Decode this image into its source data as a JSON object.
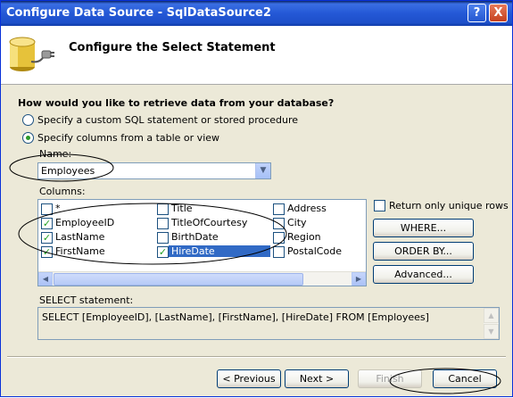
{
  "window": {
    "title": "Configure Data Source - SqlDataSource2",
    "help_glyph": "?",
    "close_glyph": "X"
  },
  "header": {
    "step_title": "Configure the Select Statement",
    "icon": "database-icon"
  },
  "retrieve": {
    "question": "How would you like to retrieve data from your database?",
    "options": [
      {
        "label": "Specify a custom SQL statement or stored procedure",
        "selected": false
      },
      {
        "label": "Specify columns from a table or view",
        "selected": true
      }
    ]
  },
  "name_field": {
    "label": "Name:",
    "value": "Employees"
  },
  "columns": {
    "label": "Columns:",
    "items": [
      {
        "label": "*",
        "checked": false
      },
      {
        "label": "EmployeeID",
        "checked": true
      },
      {
        "label": "LastName",
        "checked": true
      },
      {
        "label": "FirstName",
        "checked": true
      },
      {
        "label": "Title",
        "checked": false
      },
      {
        "label": "TitleOfCourtesy",
        "checked": false
      },
      {
        "label": "BirthDate",
        "checked": false
      },
      {
        "label": "HireDate",
        "checked": true
      },
      {
        "label": "Address",
        "checked": false
      },
      {
        "label": "City",
        "checked": false
      },
      {
        "label": "Region",
        "checked": false
      },
      {
        "label": "PostalCode",
        "checked": false
      }
    ]
  },
  "side_options": {
    "unique_rows_label": "Return only unique rows",
    "unique_rows_checked": false,
    "where_label": "WHERE...",
    "order_by_label": "ORDER BY...",
    "advanced_label": "Advanced..."
  },
  "select_statement": {
    "label": "SELECT statement:",
    "text": "SELECT [EmployeeID], [LastName], [FirstName], [HireDate] FROM [Employees]"
  },
  "footer": {
    "previous_label": "< Previous",
    "next_label": "Next >",
    "finish_label": "Finish",
    "cancel_label": "Cancel"
  },
  "colors": {
    "title_bar": "#2458d6",
    "selection": "#316ac5",
    "check_green": "#21a121"
  }
}
